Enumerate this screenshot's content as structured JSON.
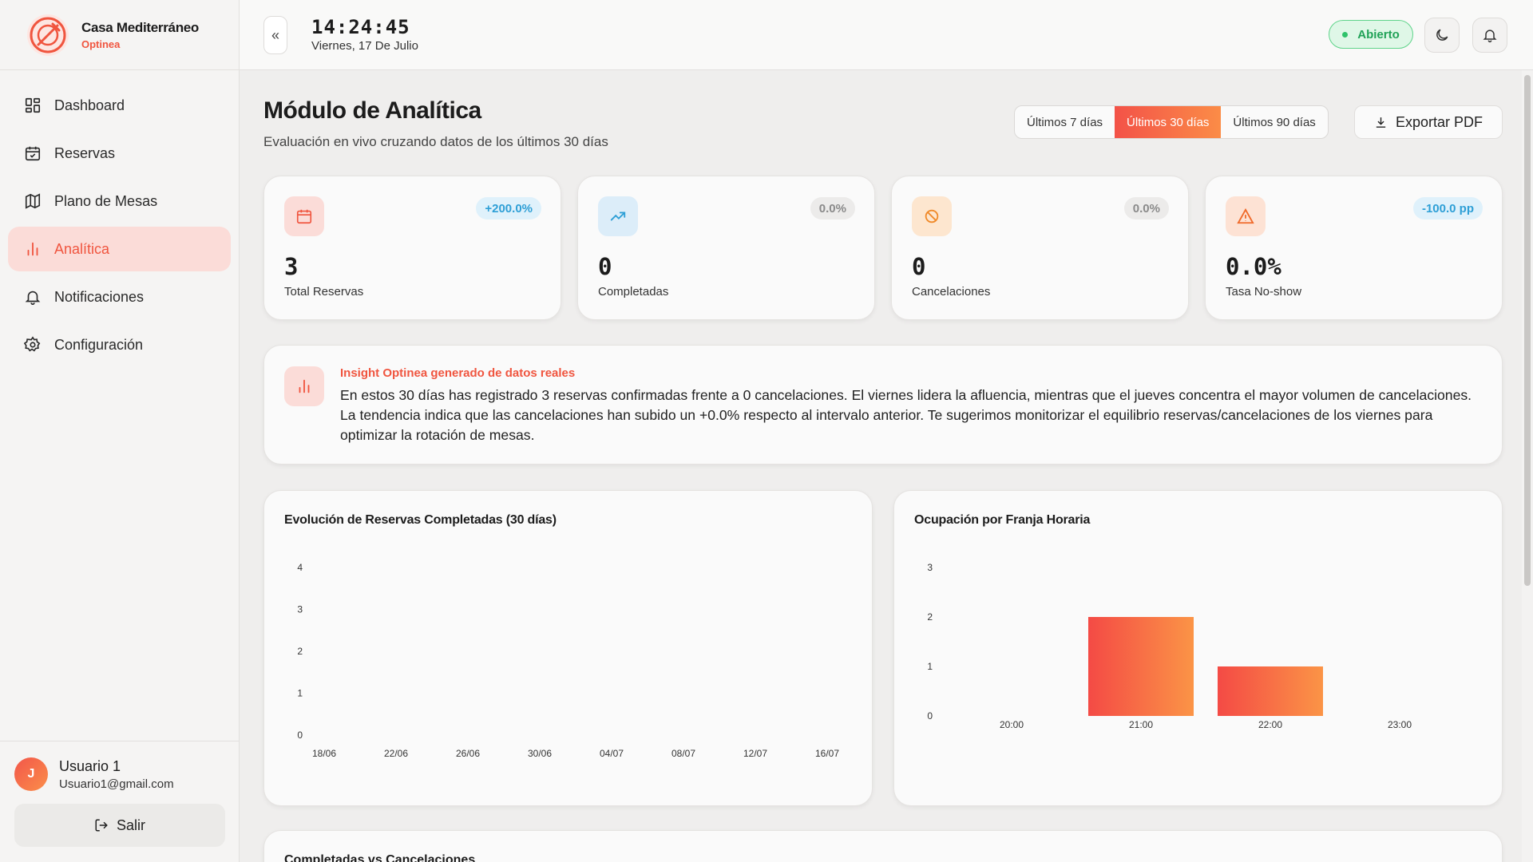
{
  "brand": {
    "name": "Casa Mediterráneo",
    "subtitle": "Optinea",
    "accent": "#f0553f"
  },
  "sidebar": {
    "items": [
      {
        "label": "Dashboard",
        "icon": "dashboard-icon",
        "active": false
      },
      {
        "label": "Reservas",
        "icon": "calendar-icon",
        "active": false
      },
      {
        "label": "Plano de Mesas",
        "icon": "map-icon",
        "active": false
      },
      {
        "label": "Analítica",
        "icon": "bar-chart-icon",
        "active": true
      },
      {
        "label": "Notificaciones",
        "icon": "bell-icon",
        "active": false
      },
      {
        "label": "Configuración",
        "icon": "gear-icon",
        "active": false
      }
    ]
  },
  "user": {
    "initial": "J",
    "name": "Usuario 1",
    "email": "Usuario1@gmail.com",
    "logout_label": "Salir"
  },
  "topbar": {
    "collapse_glyph": "«",
    "time": "14:24:45",
    "date": "Viernes, 17 De Julio",
    "status": "Abierto",
    "status_color": "#21a257"
  },
  "page": {
    "title": "Módulo de Analítica",
    "subtitle": "Evaluación en vivo cruzando datos de los últimos 30 días",
    "ranges": [
      "Últimos 7 días",
      "Últimos 30 días",
      "Últimos 90 días"
    ],
    "active_range": "Últimos 30 días",
    "export_label": "Exportar PDF"
  },
  "kpis": [
    {
      "value": "3",
      "label": "Total Reservas",
      "delta": "+200.0%",
      "icon": "calendar-icon",
      "color": "#f0553f"
    },
    {
      "value": "0",
      "label": "Completadas",
      "delta": "0.0%",
      "icon": "trending-up-icon",
      "color": "#2e9fd6"
    },
    {
      "value": "0",
      "label": "Cancelaciones",
      "delta": "0.0%",
      "icon": "ban-icon",
      "color": "#f08a2a"
    },
    {
      "value": "0.0%",
      "label": "Tasa No-show",
      "delta": "-100.0 pp",
      "icon": "warning-icon",
      "color": "#f06a2a"
    }
  ],
  "insight": {
    "title": "Insight Optinea generado de datos reales",
    "text": "En estos 30 días has registrado 3 reservas confirmadas frente a 0 cancelaciones. El viernes lidera la afluencia, mientras que el jueves concentra el mayor volumen de cancelaciones. La tendencia indica que las cancelaciones han subido un +0.0% respecto al intervalo anterior. Te sugerimos monitorizar el equilibrio reservas/cancelaciones de los viernes para optimizar la rotación de mesas."
  },
  "bottom_card_title": "Completadas vs Cancelaciones",
  "chart_data": [
    {
      "type": "line",
      "title": "Evolución de Reservas Completadas (30 días)",
      "x": [
        "18/06",
        "22/06",
        "26/06",
        "30/06",
        "04/07",
        "08/07",
        "12/07",
        "16/07"
      ],
      "series": [
        {
          "values": [
            0,
            0,
            0,
            0,
            0,
            0,
            0,
            0
          ]
        }
      ],
      "yticks": [
        0,
        1,
        2,
        3,
        4
      ],
      "ylim": [
        0,
        4
      ],
      "grid": false
    },
    {
      "type": "bar",
      "title": "Ocupación por Franja Horaria",
      "categories": [
        "20:00",
        "21:00",
        "22:00",
        "23:00"
      ],
      "values": [
        0,
        2,
        1,
        0
      ],
      "yticks": [
        0,
        1,
        2,
        3
      ],
      "ylim": [
        0,
        3
      ],
      "grid": false
    }
  ]
}
